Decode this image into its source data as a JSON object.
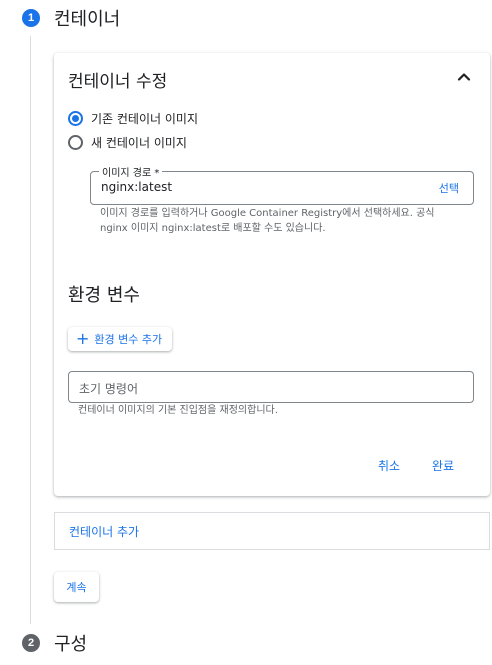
{
  "stepper": {
    "step1": {
      "number": "1",
      "title": "컨테이너"
    },
    "step2": {
      "number": "2",
      "title": "구성"
    }
  },
  "card": {
    "title": "컨테이너 수정",
    "collapse_icon": "chevron-up-icon",
    "image_options": [
      {
        "label": "기존 컨테이너 이미지",
        "checked": true
      },
      {
        "label": "새 컨테이너 이미지",
        "checked": false
      }
    ],
    "image_path": {
      "label": "이미지 경로 *",
      "value": "nginx:latest",
      "action": "선택",
      "hint": "이미지 경로를 입력하거나 Google Container Registry에서 선택하세요. 공식 nginx 이미지 nginx:latest로 배포할 수도 있습니다."
    },
    "env_section": {
      "heading": "환경 변수",
      "add_button": "환경 변수 추가"
    },
    "entrypoint": {
      "placeholder": "초기 명령어",
      "hint": "컨테이너 이미지의 기본 진입점을 재정의합니다."
    },
    "cancel_label": "취소",
    "done_label": "완료"
  },
  "add_container_label": "컨테이너 추가",
  "continue_label": "계속",
  "colors": {
    "accent": "#1a73e8",
    "step_inactive": "#5f6368",
    "border": "#dadce0"
  }
}
